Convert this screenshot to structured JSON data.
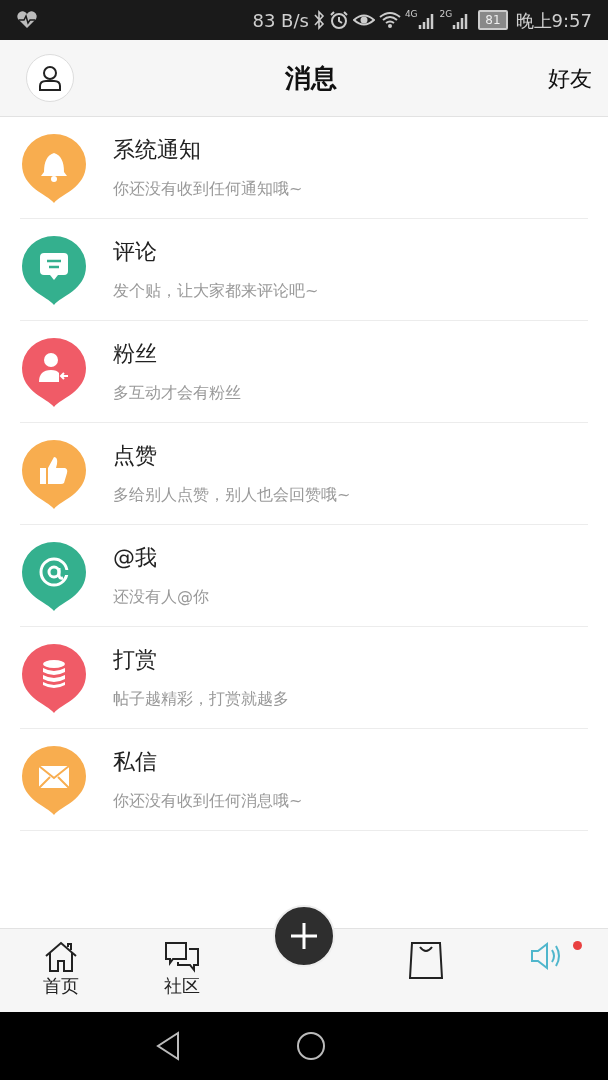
{
  "status_bar": {
    "speed": "83 B/s",
    "network_1": "4G",
    "network_2": "2G",
    "battery": "81",
    "time": "晚上9:57"
  },
  "header": {
    "title": "消息",
    "action": "好友"
  },
  "messages": [
    {
      "kind": "notice",
      "color": "#f8ad4f",
      "title": "系统通知",
      "subtitle": "你还没有收到任何通知哦~"
    },
    {
      "kind": "comment",
      "color": "#34b08e",
      "title": "评论",
      "subtitle": "发个贴，让大家都来评论吧~"
    },
    {
      "kind": "fans",
      "color": "#f05b67",
      "title": "粉丝",
      "subtitle": "多互动才会有粉丝"
    },
    {
      "kind": "like",
      "color": "#f8ad4f",
      "title": "点赞",
      "subtitle": "多给别人点赞，别人也会回赞哦~"
    },
    {
      "kind": "mention",
      "color": "#34b08e",
      "title": "@我",
      "subtitle": "还没有人@你"
    },
    {
      "kind": "reward",
      "color": "#f05b67",
      "title": "打赏",
      "subtitle": "帖子越精彩，打赏就越多"
    },
    {
      "kind": "mail",
      "color": "#f8ad4f",
      "title": "私信",
      "subtitle": "你还没有收到任何消息哦~"
    }
  ],
  "tab_bar": [
    {
      "kind": "home",
      "label": "首页",
      "selected": false,
      "badge": false
    },
    {
      "kind": "community",
      "label": "社区",
      "selected": false,
      "badge": false
    },
    {
      "kind": "add",
      "selected": false,
      "badge": false
    },
    {
      "kind": "shop",
      "selected": false,
      "badge": false
    },
    {
      "kind": "sound",
      "selected": true,
      "badge": true
    }
  ]
}
